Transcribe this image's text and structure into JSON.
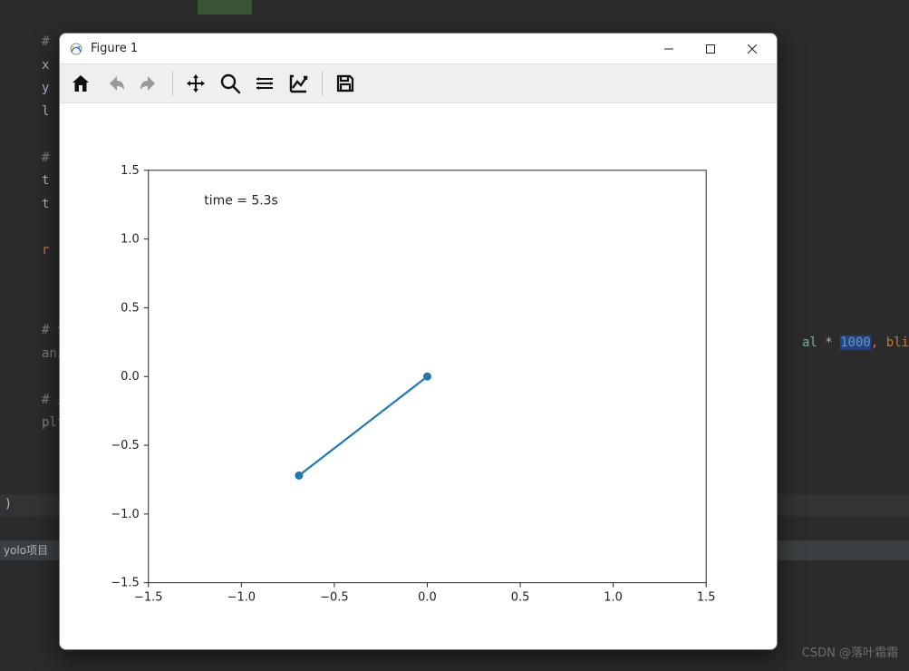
{
  "ide": {
    "lines": [
      {
        "cls": "cmt",
        "text": "#"
      },
      {
        "cls": "id",
        "text": "x"
      },
      {
        "cls": "id",
        "text": "y"
      },
      {
        "cls": "id",
        "text": "l"
      },
      {
        "cls": "",
        "text": ""
      },
      {
        "cls": "cmt",
        "text": "#"
      },
      {
        "cls": "id",
        "text": "t"
      },
      {
        "cls": "id",
        "text": "t"
      },
      {
        "cls": "",
        "text": ""
      },
      {
        "cls": "kw",
        "text": "r"
      }
    ],
    "lower_block": "# 创建\nani =\n\n# 显示\nplt.s",
    "right_snippet_prefix": "al ",
    "right_snippet_op": "* ",
    "right_snippet_num": "1000",
    "right_snippet_suffix": ",  bli",
    "tab_label": "yolo项目",
    "paren": ")"
  },
  "window": {
    "title": "Figure 1",
    "toolbar": {
      "home": "home-icon",
      "back": "back-icon",
      "forward": "forward-icon",
      "pan": "pan-icon",
      "zoom": "zoom-icon",
      "subplots": "subplots-icon",
      "axes": "edit-axes-icon",
      "save": "save-icon"
    }
  },
  "chart_data": {
    "type": "line",
    "x": [
      -0.69,
      0.0
    ],
    "y": [
      -0.72,
      0.0
    ],
    "markers": true,
    "color": "#1f77b4",
    "xlabel": "",
    "ylabel": "",
    "xlim": [
      -1.5,
      1.5
    ],
    "ylim": [
      -1.5,
      1.5
    ],
    "xticks": [
      -1.5,
      -1.0,
      -0.5,
      0.0,
      0.5,
      1.0,
      1.5
    ],
    "yticks": [
      -1.5,
      -1.0,
      -0.5,
      0.0,
      0.5,
      1.0,
      1.5
    ],
    "xtick_labels": [
      "−1.5",
      "−1.0",
      "−0.5",
      "0.0",
      "0.5",
      "1.0",
      "1.5"
    ],
    "ytick_labels": [
      "−1.5",
      "−1.0",
      "−0.5",
      "0.0",
      "0.5",
      "1.0",
      "1.5"
    ],
    "annotation": {
      "text": "time = 5.3s",
      "x": -1.2,
      "y": 1.25
    }
  },
  "watermark": "CSDN @落叶霜霜"
}
